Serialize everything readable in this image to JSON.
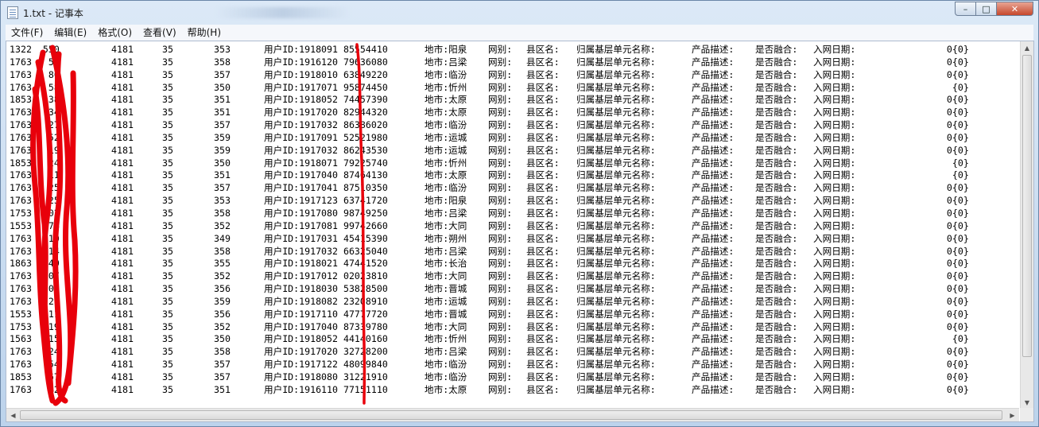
{
  "window": {
    "title": "1.txt - 记事本",
    "minimize_label": "–",
    "maximize_label": "□",
    "close_label": "✕"
  },
  "menu": [
    {
      "label": "文件(F)"
    },
    {
      "label": "编辑(E)"
    },
    {
      "label": "格式(O)"
    },
    {
      "label": "查看(V)"
    },
    {
      "label": "帮助(H)"
    }
  ],
  "rows": [
    {
      "phone": "1322  550",
      "a": "4181",
      "b": "35",
      "c": "353",
      "uid": "用户ID:1918091 85554410",
      "city": "地市:阳泉",
      "net": "网别:",
      "county": "县区名:",
      "base": "归属基层单元名称:",
      "prod": "产品描述:",
      "fuse": "是否融合:",
      "date": "入网日期:",
      "tail": "    0{0}"
    },
    {
      "phone": "1763   59",
      "a": "4181",
      "b": "35",
      "c": "358",
      "uid": "用户ID:1916120 79636080",
      "city": "地市:吕梁",
      "net": "网别:",
      "county": "县区名:",
      "base": "归属基层单元名称:",
      "prod": "产品描述:",
      "fuse": "是否融合:",
      "date": "入网日期:",
      "tail": "    0{0}"
    },
    {
      "phone": "1763   80",
      "a": "4181",
      "b": "35",
      "c": "357",
      "uid": "用户ID:1918010 63849220",
      "city": "地市:临汾",
      "net": "网别:",
      "county": "县区名:",
      "base": "归属基层单元名称:",
      "prod": "产品描述:",
      "fuse": "是否融合:",
      "date": "入网日期:",
      "tail": "    0{0}"
    },
    {
      "phone": "1763   58",
      "a": "4181",
      "b": "35",
      "c": "350",
      "uid": "用户ID:1917071 95874450",
      "city": "地市:忻州",
      "net": "网别:",
      "county": "县区名:",
      "base": "归属基层单元名称:",
      "prod": "产品描述:",
      "fuse": "是否融合:",
      "date": "入网日期:",
      "tail": "     {0}"
    },
    {
      "phone": "1853   38",
      "a": "4181",
      "b": "35",
      "c": "351",
      "uid": "用户ID:1918052 74457390",
      "city": "地市:太原",
      "net": "网别:",
      "county": "县区名:",
      "base": "归属基层单元名称:",
      "prod": "产品描述:",
      "fuse": "是否融合:",
      "date": "入网日期:",
      "tail": "    0{0}"
    },
    {
      "phone": "1763   34",
      "a": "4181",
      "b": "35",
      "c": "351",
      "uid": "用户ID:1917020 82944320",
      "city": "地市:太原",
      "net": "网别:",
      "county": "县区名:",
      "base": "归属基层单元名称:",
      "prod": "产品描述:",
      "fuse": "是否融合:",
      "date": "入网日期:",
      "tail": "    0{0}"
    },
    {
      "phone": "1763   27",
      "a": "4181",
      "b": "35",
      "c": "357",
      "uid": "用户ID:1917032 86386020",
      "city": "地市:临汾",
      "net": "网别:",
      "county": "县区名:",
      "base": "归属基层单元名称:",
      "prod": "产品描述:",
      "fuse": "是否融合:",
      "date": "入网日期:",
      "tail": "    0{0}"
    },
    {
      "phone": "1763   52",
      "a": "4181",
      "b": "35",
      "c": "359",
      "uid": "用户ID:1917091 52521980",
      "city": "地市:运城",
      "net": "网别:",
      "county": "县区名:",
      "base": "归属基层单元名称:",
      "prod": "产品描述:",
      "fuse": "是否融合:",
      "date": "入网日期:",
      "tail": "    0{0}"
    },
    {
      "phone": "1763   19",
      "a": "4181",
      "b": "35",
      "c": "359",
      "uid": "用户ID:1917032 86243530",
      "city": "地市:运城",
      "net": "网别:",
      "county": "县区名:",
      "base": "归属基层单元名称:",
      "prod": "产品描述:",
      "fuse": "是否融合:",
      "date": "入网日期:",
      "tail": "    0{0}"
    },
    {
      "phone": "1853   24",
      "a": "4181",
      "b": "35",
      "c": "350",
      "uid": "用户ID:1918071 79225740",
      "city": "地市:忻州",
      "net": "网别:",
      "county": "县区名:",
      "base": "归属基层单元名称:",
      "prod": "产品描述:",
      "fuse": "是否融合:",
      "date": "入网日期:",
      "tail": "     {0}"
    },
    {
      "phone": "1763   11",
      "a": "4181",
      "b": "35",
      "c": "351",
      "uid": "用户ID:1917040 87464130",
      "city": "地市:太原",
      "net": "网别:",
      "county": "县区名:",
      "base": "归属基层单元名称:",
      "prod": "产品描述:",
      "fuse": "是否融合:",
      "date": "入网日期:",
      "tail": "     {0}"
    },
    {
      "phone": "1763   25",
      "a": "4181",
      "b": "35",
      "c": "357",
      "uid": "用户ID:1917041 87510350",
      "city": "地市:临汾",
      "net": "网别:",
      "county": "县区名:",
      "base": "归属基层单元名称:",
      "prod": "产品描述:",
      "fuse": "是否融合:",
      "date": "入网日期:",
      "tail": "    0{0}"
    },
    {
      "phone": "1763   25",
      "a": "4181",
      "b": "35",
      "c": "353",
      "uid": "用户ID:1917123 63741720",
      "city": "地市:阳泉",
      "net": "网别:",
      "county": "县区名:",
      "base": "归属基层单元名称:",
      "prod": "产品描述:",
      "fuse": "是否融合:",
      "date": "入网日期:",
      "tail": "    0{0}"
    },
    {
      "phone": "1753   02",
      "a": "4181",
      "b": "35",
      "c": "358",
      "uid": "用户ID:1917080 98749250",
      "city": "地市:吕梁",
      "net": "网别:",
      "county": "县区名:",
      "base": "归属基层单元名称:",
      "prod": "产品描述:",
      "fuse": "是否融合:",
      "date": "入网日期:",
      "tail": "    0{0}"
    },
    {
      "phone": "1553   74",
      "a": "4181",
      "b": "35",
      "c": "352",
      "uid": "用户ID:1917081 99742660",
      "city": "地市:大同",
      "net": "网别:",
      "county": "县区名:",
      "base": "归属基层单元名称:",
      "prod": "产品描述:",
      "fuse": "是否融合:",
      "date": "入网日期:",
      "tail": "    0{0}"
    },
    {
      "phone": "1763   10",
      "a": "4181",
      "b": "35",
      "c": "349",
      "uid": "用户ID:1917031 45415390",
      "city": "地市:朔州",
      "net": "网别:",
      "county": "县区名:",
      "base": "归属基层单元名称:",
      "prod": "产品描述:",
      "fuse": "是否融合:",
      "date": "入网日期:",
      "tail": "    0{0}"
    },
    {
      "phone": "1763   14",
      "a": "4181",
      "b": "35",
      "c": "358",
      "uid": "用户ID:1917032 66325040",
      "city": "地市:吕梁",
      "net": "网别:",
      "county": "县区名:",
      "base": "归属基层单元名称:",
      "prod": "产品描述:",
      "fuse": "是否融合:",
      "date": "入网日期:",
      "tail": "    0{0}"
    },
    {
      "phone": "1863   40",
      "a": "4181",
      "b": "35",
      "c": "355",
      "uid": "用户ID:1918021 47441520",
      "city": "地市:长治",
      "net": "网别:",
      "county": "县区名:",
      "base": "归属基层单元名称:",
      "prod": "产品描述:",
      "fuse": "是否融合:",
      "date": "入网日期:",
      "tail": "    0{0}"
    },
    {
      "phone": "1763   07",
      "a": "4181",
      "b": "35",
      "c": "352",
      "uid": "用户ID:1917012 02023810",
      "city": "地市:大同",
      "net": "网别:",
      "county": "县区名:",
      "base": "归属基层单元名称:",
      "prod": "产品描述:",
      "fuse": "是否融合:",
      "date": "入网日期:",
      "tail": "    0{0}"
    },
    {
      "phone": "1763   01",
      "a": "4181",
      "b": "35",
      "c": "356",
      "uid": "用户ID:1918030 53828500",
      "city": "地市:晋城",
      "net": "网别:",
      "county": "县区名:",
      "base": "归属基层单元名称:",
      "prod": "产品描述:",
      "fuse": "是否融合:",
      "date": "入网日期:",
      "tail": "    0{0}"
    },
    {
      "phone": "1763   26",
      "a": "4181",
      "b": "35",
      "c": "359",
      "uid": "用户ID:1918082 23208910",
      "city": "地市:运城",
      "net": "网别:",
      "county": "县区名:",
      "base": "归属基层单元名称:",
      "prod": "产品描述:",
      "fuse": "是否融合:",
      "date": "入网日期:",
      "tail": "    0{0}"
    },
    {
      "phone": "1553   11",
      "a": "4181",
      "b": "35",
      "c": "356",
      "uid": "用户ID:1917110 47777720",
      "city": "地市:晋城",
      "net": "网别:",
      "county": "县区名:",
      "base": "归属基层单元名称:",
      "prod": "产品描述:",
      "fuse": "是否融合:",
      "date": "入网日期:",
      "tail": "    0{0}"
    },
    {
      "phone": "1753   19",
      "a": "4181",
      "b": "35",
      "c": "352",
      "uid": "用户ID:1917040 87339780",
      "city": "地市:大同",
      "net": "网别:",
      "county": "县区名:",
      "base": "归属基层单元名称:",
      "prod": "产品描述:",
      "fuse": "是否融合:",
      "date": "入网日期:",
      "tail": "    0{0}"
    },
    {
      "phone": "1563   15",
      "a": "4181",
      "b": "35",
      "c": "350",
      "uid": "用户ID:1918052 44140160",
      "city": "地市:忻州",
      "net": "网别:",
      "county": "县区名:",
      "base": "归属基层单元名称:",
      "prod": "产品描述:",
      "fuse": "是否融合:",
      "date": "入网日期:",
      "tail": "     {0}"
    },
    {
      "phone": "1763   24",
      "a": "4181",
      "b": "35",
      "c": "358",
      "uid": "用户ID:1917020 32728200",
      "city": "地市:吕梁",
      "net": "网别:",
      "county": "县区名:",
      "base": "归属基层单元名称:",
      "prod": "产品描述:",
      "fuse": "是否融合:",
      "date": "入网日期:",
      "tail": "    0{0}"
    },
    {
      "phone": "1763   54",
      "a": "4181",
      "b": "35",
      "c": "357",
      "uid": "用户ID:1917122 48099840",
      "city": "地市:临汾",
      "net": "网别:",
      "county": "县区名:",
      "base": "归属基层单元名称:",
      "prod": "产品描述:",
      "fuse": "是否融合:",
      "date": "入网日期:",
      "tail": "    0{0}"
    },
    {
      "phone": "1853   67",
      "a": "4181",
      "b": "35",
      "c": "357",
      "uid": "用户ID:1918080 31221910",
      "city": "地市:临汾",
      "net": "网别:",
      "county": "县区名:",
      "base": "归属基层单元名称:",
      "prod": "产品描述:",
      "fuse": "是否融合:",
      "date": "入网日期:",
      "tail": "    0{0}"
    },
    {
      "phone": "1763   22",
      "a": "4181",
      "b": "35",
      "c": "351",
      "uid": "用户ID:1916110 77151110",
      "city": "地市:太原",
      "net": "网别:",
      "county": "县区名:",
      "base": "归属基层单元名称:",
      "prod": "产品描述:",
      "fuse": "是否融合:",
      "date": "入网日期:",
      "tail": "    0{0}"
    }
  ],
  "colors": {
    "redaction": "#e8000b",
    "title_gradient_top": "#dce9f7",
    "close_button": "#c7482c"
  },
  "icons": {
    "app": "notepad-icon",
    "scroll_up": "up-arrow-icon",
    "scroll_down": "down-arrow-icon",
    "scroll_left": "left-arrow-icon",
    "scroll_right": "right-arrow-icon"
  }
}
